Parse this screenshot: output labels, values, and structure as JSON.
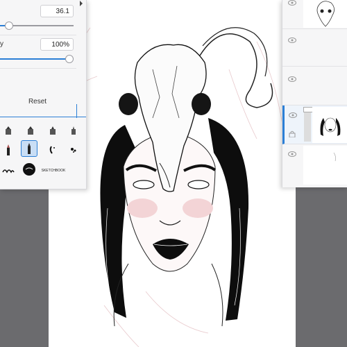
{
  "brush_panel": {
    "size_value": "36.1",
    "size_percent": 0.12,
    "opacity_label": "y",
    "opacity_value": "100%",
    "opacity_percent": 1.0,
    "reset_label": "Reset",
    "collapse_icon": "chevron-right-icon",
    "brushes": [
      {
        "name": "marker-brush-1",
        "icon": "marker-icon",
        "selected": false
      },
      {
        "name": "marker-brush-2",
        "icon": "marker-icon",
        "selected": false
      },
      {
        "name": "marker-brush-3",
        "icon": "marker-icon",
        "selected": false
      },
      {
        "name": "marker-brush-4",
        "icon": "marker-icon",
        "selected": false
      },
      {
        "name": "ink-pen-brush",
        "icon": "pen-icon",
        "selected": false
      },
      {
        "name": "ink-nib-brush",
        "icon": "pen-icon",
        "selected": true
      },
      {
        "name": "feather-brush",
        "icon": "feather-icon",
        "selected": false
      },
      {
        "name": "splatter-brush",
        "icon": "splatter-icon",
        "selected": false
      },
      {
        "name": "lettering-brush",
        "icon": "lettering-icon",
        "selected": false
      },
      {
        "name": "badge-brush",
        "icon": "badge-icon",
        "selected": false
      },
      {
        "name": "text-brush",
        "icon": "text-icon",
        "selected": false,
        "label": "SKETCHBOOK"
      }
    ]
  },
  "layer_panel": {
    "layers": [
      {
        "name": "layer-skull",
        "visible": true,
        "active": false
      },
      {
        "name": "layer-empty-1",
        "visible": true,
        "active": false
      },
      {
        "name": "layer-empty-2",
        "visible": true,
        "active": false
      },
      {
        "name": "layer-portrait",
        "visible": true,
        "active": true,
        "locked": true
      },
      {
        "name": "layer-sketch",
        "visible": true,
        "active": false
      }
    ]
  },
  "colors": {
    "accent": "#2b7fd6",
    "panel_bg": "#f6f6f7",
    "canvas_bg": "#6b6b6e",
    "ink": "#111111"
  }
}
